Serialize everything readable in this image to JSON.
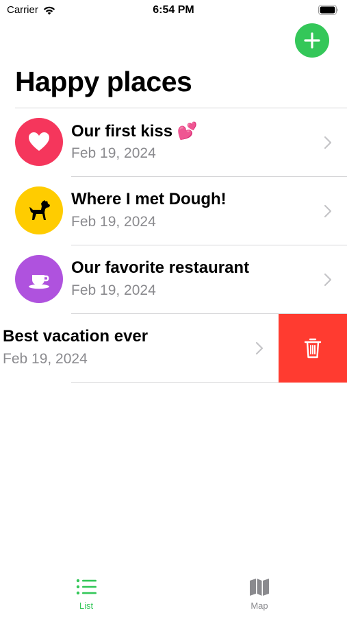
{
  "status_bar": {
    "carrier": "Carrier",
    "time": "6:54 PM"
  },
  "header": {
    "title": "Happy places",
    "add_button_icon": "plus-icon",
    "accent_color": "#34c759"
  },
  "places": [
    {
      "title": "Our first kiss 💕",
      "date": "Feb 19, 2024",
      "icon": "heart-icon",
      "color": "#f5365c"
    },
    {
      "title": "Where I met Dough!",
      "date": "Feb 19, 2024",
      "icon": "dog-icon",
      "color": "#ffcc00"
    },
    {
      "title": "Our favorite restaurant",
      "date": "Feb 19, 2024",
      "icon": "coffee-cup-icon",
      "color": "#af52de"
    },
    {
      "title": "Best vacation ever",
      "date": "Feb 19, 2024",
      "icon": "",
      "color": "",
      "swiped": true,
      "action_icon": "trash-icon",
      "action_color": "#ff3b30"
    }
  ],
  "tab_bar": {
    "tabs": [
      {
        "label": "List",
        "icon": "list-icon",
        "selected": true
      },
      {
        "label": "Map",
        "icon": "map-icon",
        "selected": false
      }
    ]
  }
}
